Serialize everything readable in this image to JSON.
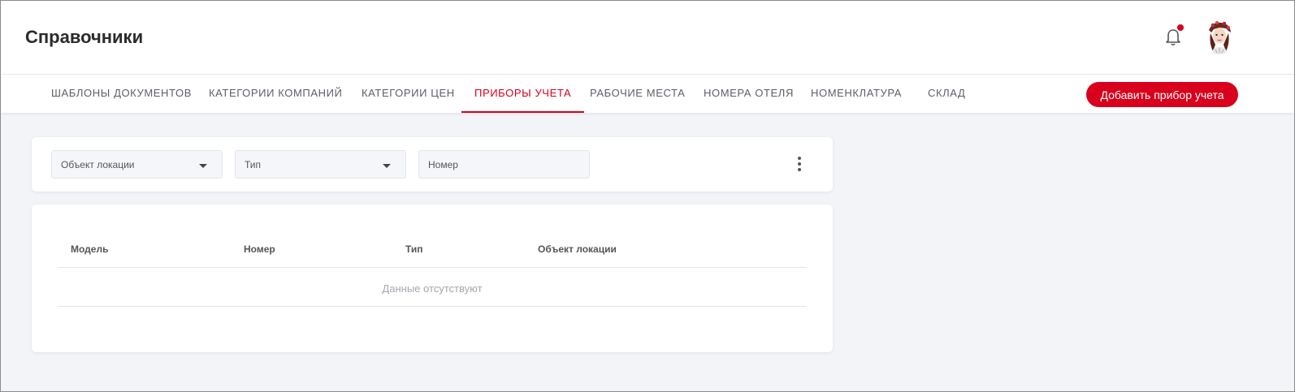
{
  "header": {
    "title": "Справочники"
  },
  "icons": {
    "bell": "bell-icon",
    "avatar": "user-avatar"
  },
  "colors": {
    "accent": "#d8001c",
    "background": "#f2f4f8",
    "notification_dot": "#d8001c"
  },
  "tabs": [
    {
      "label": "ШАБЛОНЫ ДОКУМЕНТОВ",
      "active": false
    },
    {
      "label": "КАТЕГОРИИ КОМПАНИЙ",
      "active": false
    },
    {
      "label": "КАТЕГОРИИ ЦЕН",
      "active": false
    },
    {
      "label": "ПРИБОРЫ УЧЕТА",
      "active": true
    },
    {
      "label": "РАБОЧИЕ МЕСТА",
      "active": false
    },
    {
      "label": "НОМЕРА ОТЕЛЯ",
      "active": false
    },
    {
      "label": "НОМЕНКЛАТУРА",
      "active": false
    },
    {
      "label": "СКЛАД",
      "active": false
    }
  ],
  "actions": {
    "add_label": "Добавить прибор учета"
  },
  "filters": {
    "location": {
      "placeholder": "Объект локации"
    },
    "type": {
      "placeholder": "Тип"
    },
    "number": {
      "placeholder": "Номер"
    }
  },
  "table": {
    "columns": [
      "Модель",
      "Номер",
      "Тип",
      "Объект локации"
    ],
    "rows": [],
    "empty_text": "Данные отсутствуют"
  }
}
